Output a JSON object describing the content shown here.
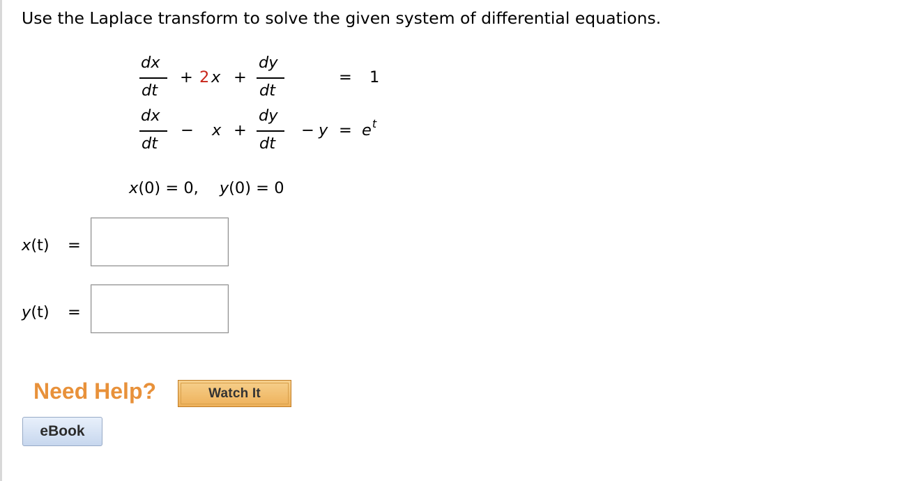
{
  "prompt": "Use the Laplace transform to solve the given system of differential equations.",
  "equations": {
    "eq1": {
      "dx_num": "dx",
      "dx_den": "dt",
      "plus1": "+",
      "coef": "2",
      "var_x": "x",
      "plus2": "+",
      "dy_num": "dy",
      "dy_den": "dt",
      "eq": "=",
      "rhs": "1"
    },
    "eq2": {
      "dx_num": "dx",
      "dx_den": "dt",
      "minus1": "−",
      "var_x": "x",
      "plus": "+",
      "dy_num": "dy",
      "dy_den": "dt",
      "minus2": "−",
      "var_y": "y",
      "eq": "=",
      "rhs_base": "e",
      "rhs_exp": "t"
    },
    "initial_conditions": {
      "x0_lhs": "x",
      "x0_arg": "(0)",
      "x0_rhs": " = 0,",
      "y0_lhs": "y",
      "y0_arg": "(0)",
      "y0_rhs": " = 0"
    }
  },
  "answers": {
    "x_label": "x",
    "x_arg": "(t)",
    "x_eq": "=",
    "x_value": "",
    "y_label": "y",
    "y_arg": "(t)",
    "y_eq": "=",
    "y_value": ""
  },
  "help": {
    "heading": "Need Help?",
    "watch_label": "Watch It",
    "ebook_label": "eBook"
  },
  "colors": {
    "need_help": "#e8913a",
    "coefficient": "#c8251a"
  }
}
